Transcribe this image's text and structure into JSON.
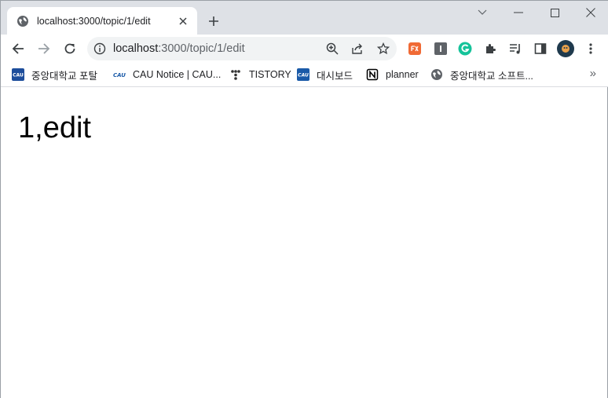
{
  "tab": {
    "title": "localhost:3000/topic/1/edit"
  },
  "toolbar": {
    "url_host": "localhost",
    "url_path": ":3000/topic/1/edit"
  },
  "bookmarks": [
    {
      "label": "중앙대학교 포탈",
      "icon": "cau-icon",
      "color": "#1d4d9b"
    },
    {
      "label": "CAU Notice | CAU...",
      "icon": "cau-logo-icon",
      "color": "#1a5aa8"
    },
    {
      "label": "TISTORY",
      "icon": "tistory-icon",
      "color": "#333333"
    },
    {
      "label": "대시보드",
      "icon": "cau-logo-icon",
      "color": "#1a5aa8"
    },
    {
      "label": "planner",
      "icon": "notion-icon",
      "color": "#000000"
    },
    {
      "label": "중앙대학교 소프트...",
      "icon": "globe-icon",
      "color": "#5f6368"
    }
  ],
  "bookmarks_more": "»",
  "page": {
    "heading": "1,edit"
  },
  "colors": {
    "tabstrip": "#dee1e6",
    "omnibox": "#f1f3f4",
    "icon_gray": "#5f6368"
  }
}
